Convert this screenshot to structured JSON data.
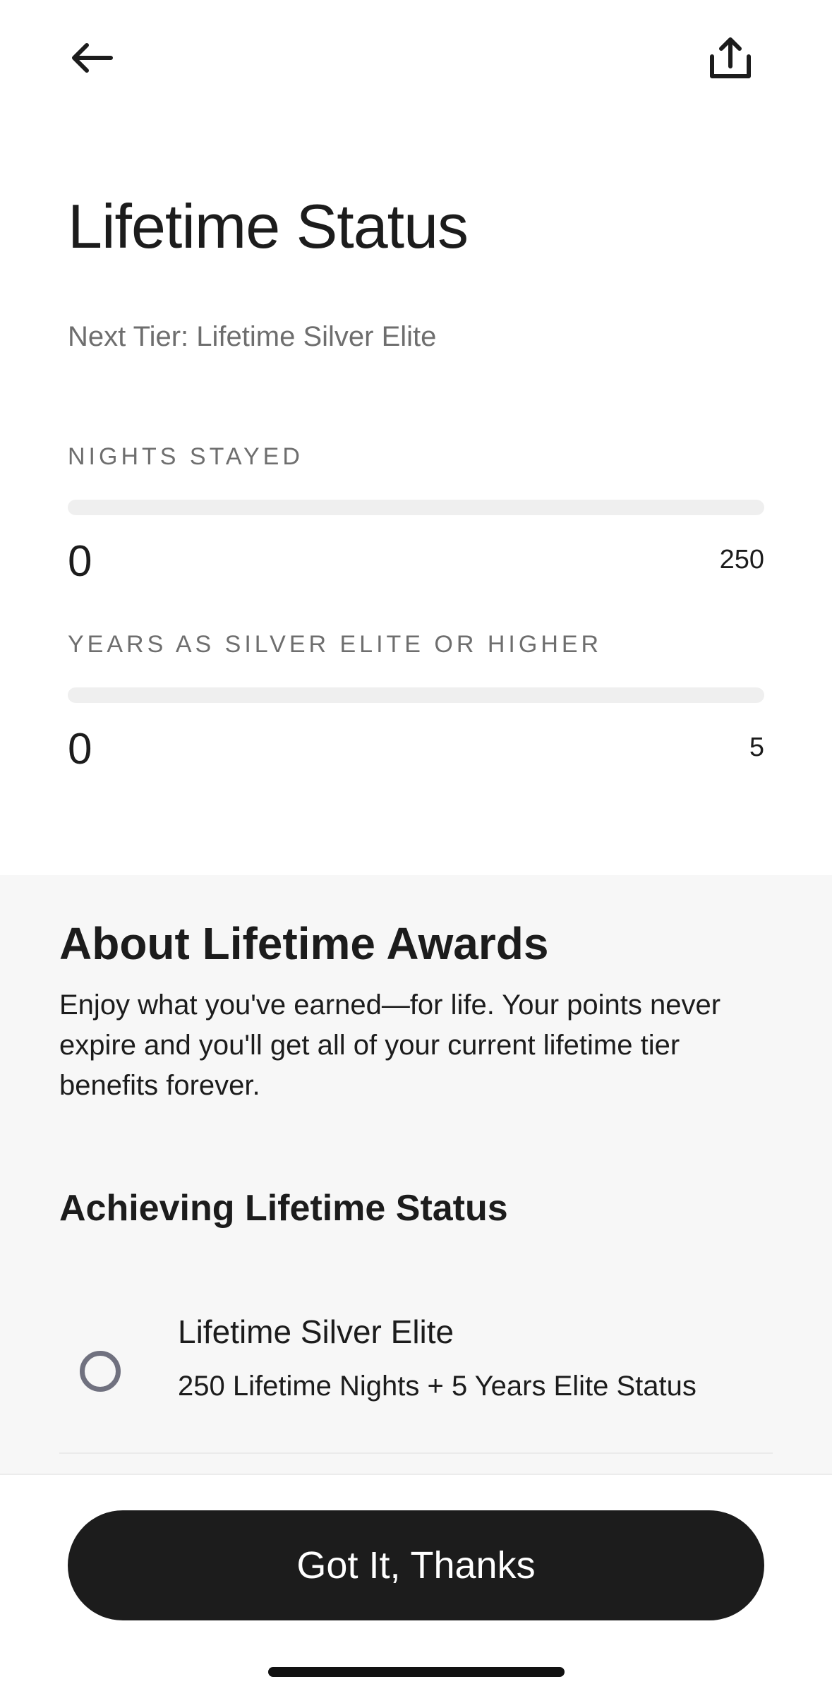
{
  "header": {
    "back_icon": "arrow-left-icon",
    "share_icon": "share-upload-icon"
  },
  "title": "Lifetime Status",
  "next_tier": "Next Tier: Lifetime Silver Elite",
  "metrics": [
    {
      "label": "NIGHTS STAYED",
      "current": "0",
      "max": "250",
      "progress_fraction": 0
    },
    {
      "label": "YEARS AS SILVER ELITE OR HIGHER",
      "current": "0",
      "max": "5",
      "progress_fraction": 0
    }
  ],
  "about": {
    "title": "About Lifetime Awards",
    "body": "Enjoy what you've earned—for life. Your points never expire and you'll get all of your current lifetime tier benefits forever.",
    "achieving_title": "Achieving Lifetime Status",
    "tiers": [
      {
        "name": "Lifetime Silver Elite",
        "requirement": "250 Lifetime Nights + 5 Years Elite Status",
        "status_icon": "empty-circle-icon"
      }
    ]
  },
  "footer": {
    "cta_label": "Got It, Thanks"
  },
  "colors": {
    "text": "#1c1c1c",
    "muted": "#6e6e6e",
    "track": "#efefef",
    "section_bg": "#f7f7f7",
    "button_bg": "#1c1c1c",
    "circle": "#70717f"
  }
}
